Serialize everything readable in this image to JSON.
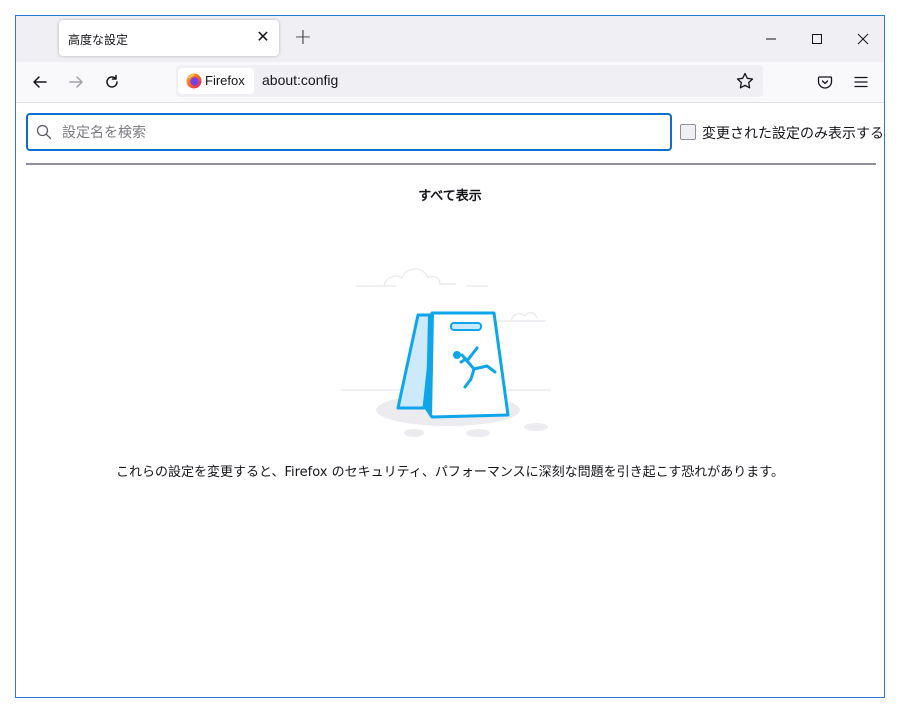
{
  "tab": {
    "title": "高度な設定",
    "close_icon": "close-icon"
  },
  "window_controls": {
    "minimize_icon": "minimize-icon",
    "maximize_icon": "maximize-icon",
    "close_icon": "close-icon"
  },
  "navbar": {
    "identity_label": "Firefox",
    "url": "about:config"
  },
  "search": {
    "placeholder": "設定名を検索",
    "value": ""
  },
  "filter": {
    "label": "変更された設定のみ表示する",
    "checked": false
  },
  "show_all_label": "すべて表示",
  "warning_text": "これらの設定を変更すると、Firefox のセキュリティ、パフォーマンスに深刻な問題を引き起こす恐れがあります。",
  "colors": {
    "accent": "#0b6fcf",
    "window_border": "#2b7bd6",
    "illustration_blue": "#0ea5e9"
  }
}
